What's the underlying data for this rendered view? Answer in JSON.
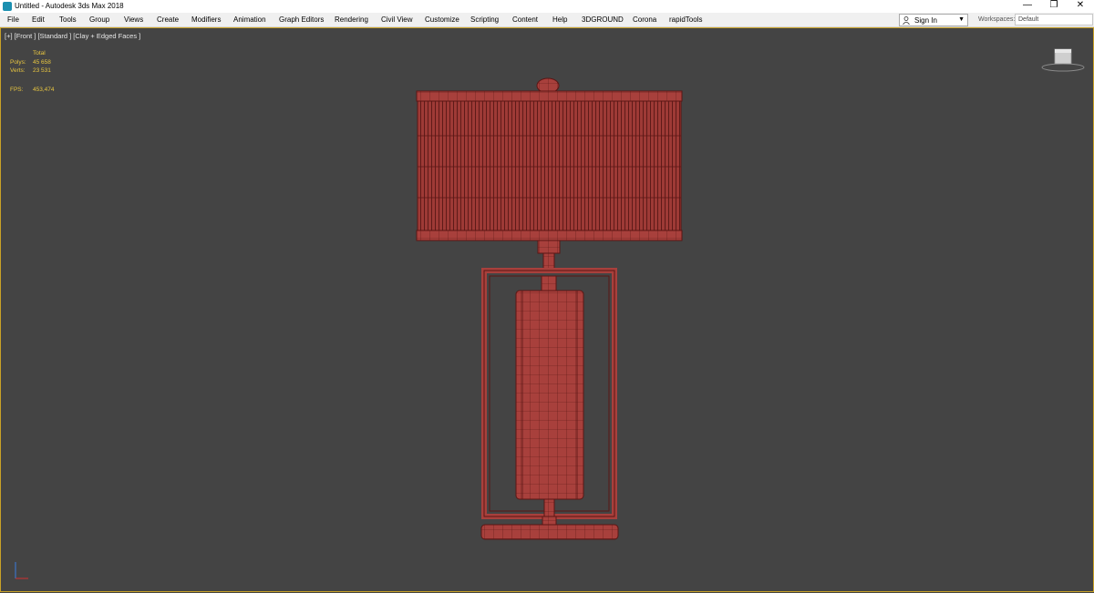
{
  "window": {
    "title": "Untitled - Autodesk 3ds Max 2018",
    "icon": "3dsmax-app-icon",
    "controls": {
      "minimize": "—",
      "maximize": "❐",
      "close": "✕"
    }
  },
  "menubar": {
    "items": [
      "File",
      "Edit",
      "Tools",
      "Group",
      "Views",
      "Create",
      "Modifiers",
      "Animation",
      "Graph Editors",
      "Rendering",
      "Civil View",
      "Customize",
      "Scripting",
      "Content",
      "Help",
      "3DGROUND",
      "Corona",
      "rapidTools"
    ],
    "signin": {
      "label": "Sign In",
      "icon": "person-icon",
      "caret": "▼"
    },
    "workspaces": {
      "label": "Workspaces:",
      "value": "Default"
    }
  },
  "viewport": {
    "label": "[+] [Front ] [Standard ] [Clay + Edged Faces ]",
    "stats": {
      "header": "Total",
      "polys_label": "Polys:",
      "polys_value": "45 658",
      "verts_label": "Verts:",
      "verts_value": "23 531",
      "fps_label": "FPS:",
      "fps_value": "453,474"
    },
    "colors": {
      "background": "#444444",
      "border": "#c9a227",
      "model_fill": "#a8403c",
      "model_wire": "#5a1614",
      "stats_text": "#e8c640"
    },
    "model": "table-lamp-wireframe",
    "viewcube": "viewcube-icon",
    "axis_gizmo": "axis-gizmo-icon"
  }
}
